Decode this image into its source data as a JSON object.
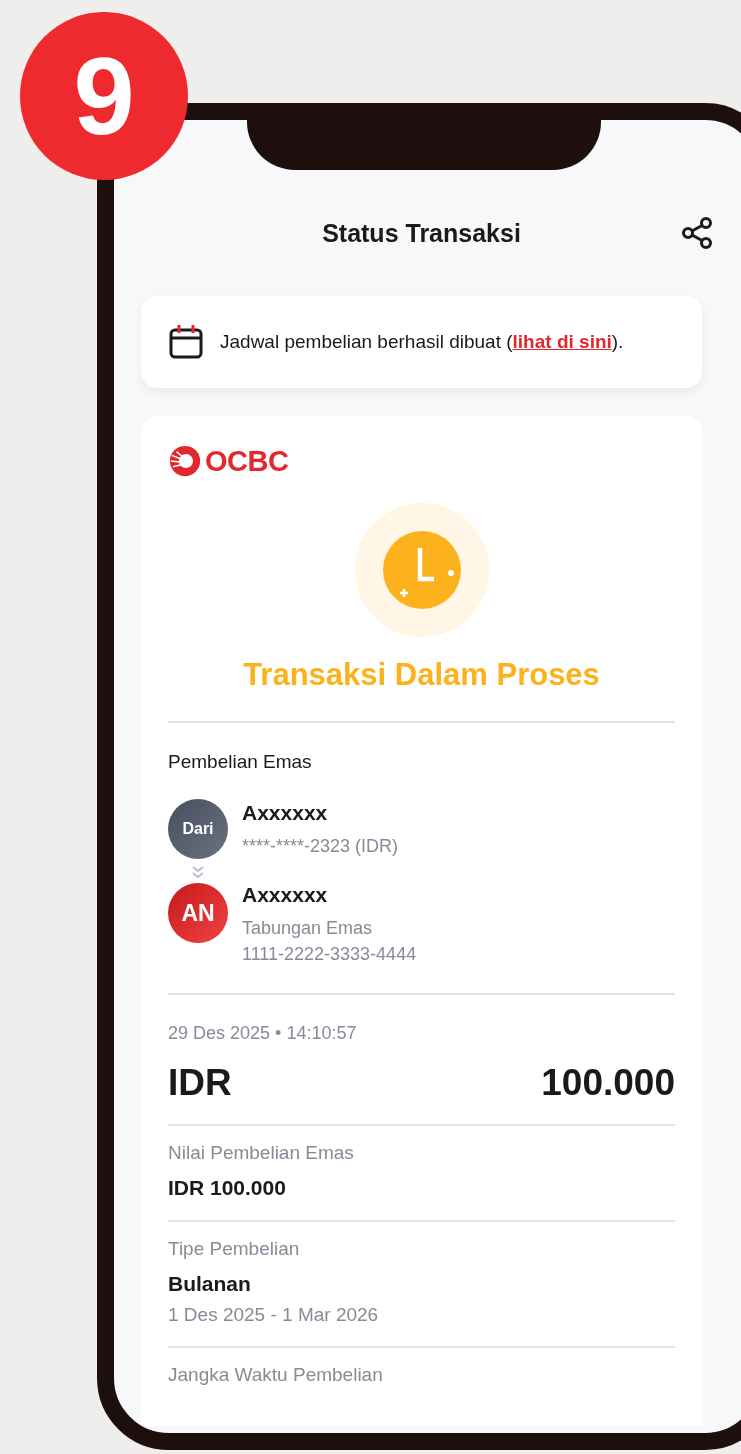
{
  "step_badge": "9",
  "header": {
    "title": "Status Transaksi"
  },
  "notice": {
    "text": "Jadwal pembelian berhasil dibuat (",
    "link": "lihat di sini",
    "suffix": ")."
  },
  "receipt": {
    "logo": "OCBC",
    "status": {
      "kind": "pending",
      "title": "Transaksi Dalam Proses"
    },
    "section_title": "Pembelian Emas",
    "from": {
      "kind": "source",
      "avatar": "Dari",
      "name": "Axxxxxx",
      "lines": [
        "****-****-2323 (IDR)"
      ]
    },
    "to": {
      "kind": "target",
      "avatar": "AN",
      "name": "Axxxxxx",
      "lines": [
        "Tabungan Emas",
        "1111-2222-3333-4444"
      ]
    },
    "timestamp": "29 Des 2025 • 14:10:57",
    "amount": {
      "currency": "IDR",
      "value": "100.000"
    },
    "details": [
      {
        "label": "Nilai Pembelian Emas",
        "value": "IDR 100.000"
      },
      {
        "label": "Tipe Pembelian",
        "value": "Bulanan",
        "note": "1 Des 2025 - 1 Mar 2026"
      },
      {
        "label": "Jangka Waktu Pembelian"
      }
    ]
  }
}
